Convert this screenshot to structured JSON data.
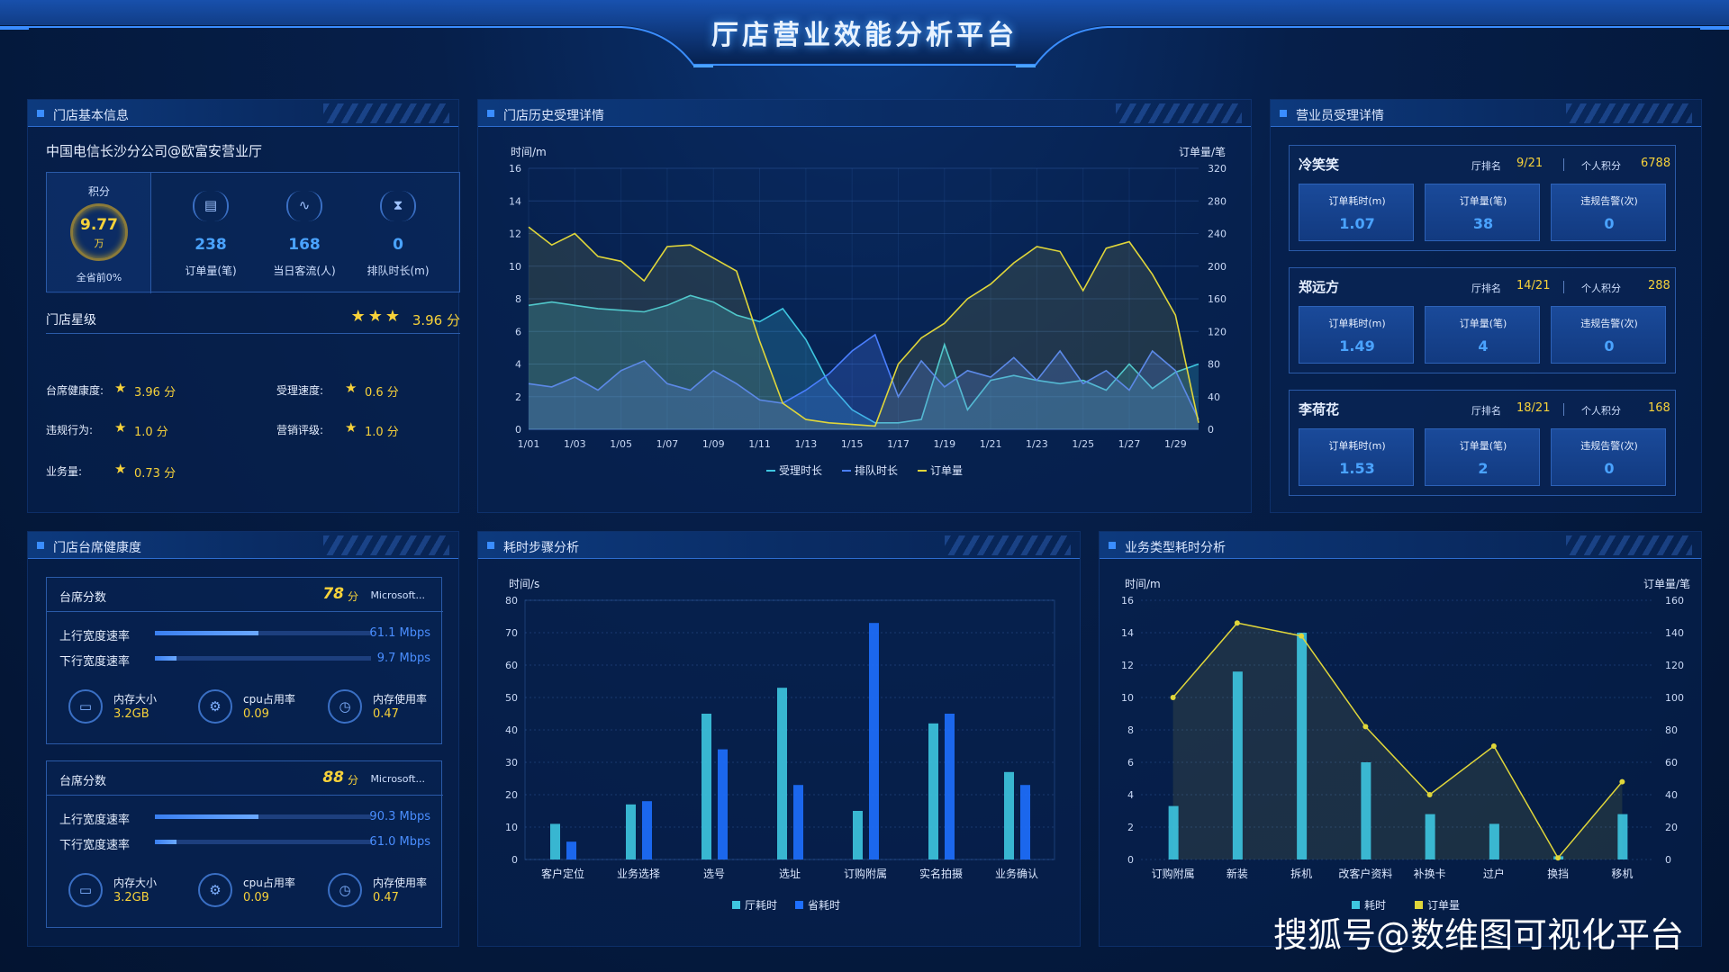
{
  "title": "厅店营业效能分析平台",
  "panels": {
    "store_info": "门店基本信息",
    "history": "门店历史受理详情",
    "staff": "营业员受理详情",
    "health": "门店台席健康度",
    "steps": "耗时步骤分析",
    "business": "业务类型耗时分析"
  },
  "store": {
    "name": "中国电信长沙分公司@欧富安营业厅",
    "score_label": "积分",
    "score_value": "9.77",
    "score_unit": "万",
    "score_rank": "全省前0%",
    "kpis": [
      {
        "icon": "clipboard-icon",
        "value": "238",
        "label": "订单量(笔)"
      },
      {
        "icon": "pulse-icon",
        "value": "168",
        "label": "当日客流(人)"
      },
      {
        "icon": "hourglass-icon",
        "value": "0",
        "label": "排队时长(m)"
      }
    ],
    "star_label": "门店星级",
    "star_value": "3.96 分",
    "star_count": 3,
    "metrics": [
      {
        "label": "台席健康度:",
        "value": "3.96 分"
      },
      {
        "label": "受理速度:",
        "value": "0.6 分"
      },
      {
        "label": "违规行为:",
        "value": "1.0 分"
      },
      {
        "label": "营销评级:",
        "value": "1.0 分"
      },
      {
        "label": "业务量:",
        "value": "0.73 分"
      }
    ]
  },
  "staff": [
    {
      "name": "冷笑笑",
      "rank_label": "厅排名",
      "rank": "9/21",
      "points_label": "个人积分",
      "points": "6788",
      "cells": [
        {
          "label": "订单耗时(m)",
          "value": "1.07"
        },
        {
          "label": "订单量(笔)",
          "value": "38"
        },
        {
          "label": "违规告警(次)",
          "value": "0"
        }
      ]
    },
    {
      "name": "郑远方",
      "rank_label": "厅排名",
      "rank": "14/21",
      "points_label": "个人积分",
      "points": "288",
      "cells": [
        {
          "label": "订单耗时(m)",
          "value": "1.49"
        },
        {
          "label": "订单量(笔)",
          "value": "4"
        },
        {
          "label": "违规告警(次)",
          "value": "0"
        }
      ]
    },
    {
      "name": "李荷花",
      "rank_label": "厅排名",
      "rank": "18/21",
      "points_label": "个人积分",
      "points": "168",
      "cells": [
        {
          "label": "订单耗时(m)",
          "value": "1.53"
        },
        {
          "label": "订单量(笔)",
          "value": "2"
        },
        {
          "label": "违规告警(次)",
          "value": "0"
        }
      ]
    }
  ],
  "health": [
    {
      "title": "台席分数",
      "score": "78",
      "score_unit": "分",
      "app": "Microsoft...",
      "up_label": "上行宽度速率",
      "up_value": "61.1 Mbps",
      "up_fraction": 0.48,
      "down_label": "下行宽度速率",
      "down_value": "9.7 Mbps",
      "down_fraction": 0.1,
      "res": [
        {
          "icon": "memory-icon",
          "label": "内存大小",
          "value": "3.2GB"
        },
        {
          "icon": "cpu-icon",
          "label": "cpu占用率",
          "value": "0.09"
        },
        {
          "icon": "clock-icon",
          "label": "内存使用率",
          "value": "0.47"
        }
      ]
    },
    {
      "title": "台席分数",
      "score": "88",
      "score_unit": "分",
      "app": "Microsoft...",
      "up_label": "上行宽度速率",
      "up_value": "90.3 Mbps",
      "up_fraction": 0.48,
      "down_label": "下行宽度速率",
      "down_value": "61.0 Mbps",
      "down_fraction": 0.1,
      "res": [
        {
          "icon": "memory-icon",
          "label": "内存大小",
          "value": "3.2GB"
        },
        {
          "icon": "cpu-icon",
          "label": "cpu占用率",
          "value": "0.09"
        },
        {
          "icon": "clock-icon",
          "label": "内存使用率",
          "value": "0.47"
        }
      ]
    }
  ],
  "watermark": "搜狐号@数维图可视化平台",
  "colors": {
    "accent": "#4aa3ff",
    "gold": "#f7d23a",
    "cyan": "#3ec6e0",
    "blue": "#1e6fff"
  },
  "chart_data": [
    {
      "type": "line",
      "ylabel": "时间/m",
      "y2label": "订单量/笔",
      "ylim": [
        0,
        16
      ],
      "y2lim": [
        0,
        320
      ],
      "yticks": [
        0,
        2,
        4,
        6,
        8,
        10,
        12,
        14,
        16
      ],
      "y2ticks": [
        0,
        40,
        80,
        120,
        160,
        200,
        240,
        280,
        320
      ],
      "x_ticks": [
        "1/01",
        "1/03",
        "1/05",
        "1/07",
        "1/09",
        "1/11",
        "1/13",
        "1/15",
        "1/17",
        "1/19",
        "1/21",
        "1/23",
        "1/25",
        "1/27",
        "1/29"
      ],
      "x_count": 30,
      "series": [
        {
          "name": "受理时长",
          "color": "#3ec6e0",
          "axis": "left",
          "values": [
            7.6,
            7.8,
            7.6,
            7.4,
            7.3,
            7.2,
            7.6,
            8.2,
            7.8,
            7.0,
            6.6,
            7.4,
            5.5,
            2.8,
            1.2,
            0.4,
            0.4,
            0.6,
            5.2,
            1.2,
            3.0,
            3.3,
            3.0,
            2.8,
            3.0,
            2.4,
            4.0,
            2.5,
            3.5,
            4.0
          ]
        },
        {
          "name": "排队时长",
          "color": "#4a7fff",
          "axis": "left",
          "values": [
            2.8,
            2.6,
            3.2,
            2.4,
            3.6,
            4.2,
            2.8,
            2.4,
            3.6,
            2.8,
            1.8,
            1.6,
            2.4,
            3.4,
            4.8,
            5.8,
            2.0,
            4.2,
            2.6,
            3.6,
            3.2,
            4.4,
            3.0,
            4.8,
            2.8,
            3.6,
            2.4,
            4.8,
            3.6,
            0.6
          ]
        },
        {
          "name": "订单量",
          "color": "#e0d63a",
          "axis": "right",
          "values": [
            248,
            226,
            240,
            212,
            206,
            182,
            224,
            226,
            210,
            194,
            108,
            32,
            12,
            8,
            6,
            4,
            80,
            112,
            130,
            160,
            178,
            204,
            224,
            218,
            170,
            222,
            230,
            190,
            140,
            8
          ]
        }
      ]
    },
    {
      "type": "bar",
      "ylabel": "时间/s",
      "ylim": [
        0,
        80
      ],
      "yticks": [
        0,
        10,
        20,
        30,
        40,
        50,
        60,
        70,
        80
      ],
      "categories": [
        "客户定位",
        "业务选择",
        "选号",
        "选址",
        "订购附属",
        "实名拍摄",
        "业务确认"
      ],
      "series": [
        {
          "name": "厅耗时",
          "color": "#3ec6e0",
          "values": [
            11,
            17,
            45,
            53,
            15,
            42,
            27
          ]
        },
        {
          "name": "省耗时",
          "color": "#1e6fff",
          "values": [
            5.5,
            18,
            34,
            23,
            73,
            45,
            23
          ]
        }
      ]
    },
    {
      "type": "bar",
      "ylabel": "时间/m",
      "y2label": "订单量/笔",
      "ylim": [
        0,
        16
      ],
      "y2lim": [
        0,
        160
      ],
      "yticks": [
        0,
        2,
        4,
        6,
        8,
        10,
        12,
        14,
        16
      ],
      "y2ticks": [
        0,
        20,
        40,
        60,
        80,
        100,
        120,
        140,
        160
      ],
      "categories": [
        "订购附属",
        "新装",
        "拆机",
        "改客户资料",
        "补换卡",
        "过户",
        "换挡",
        "移机"
      ],
      "series": [
        {
          "name": "耗时",
          "color": "#3ec6e0",
          "type": "bar",
          "axis": "left",
          "values": [
            3.3,
            11.6,
            14.0,
            6.0,
            2.8,
            2.2,
            0.2,
            2.8
          ]
        },
        {
          "name": "订单量",
          "color": "#e0d63a",
          "type": "line",
          "axis": "right",
          "values": [
            100,
            146,
            138,
            82,
            40,
            70,
            1,
            48
          ]
        }
      ]
    }
  ]
}
